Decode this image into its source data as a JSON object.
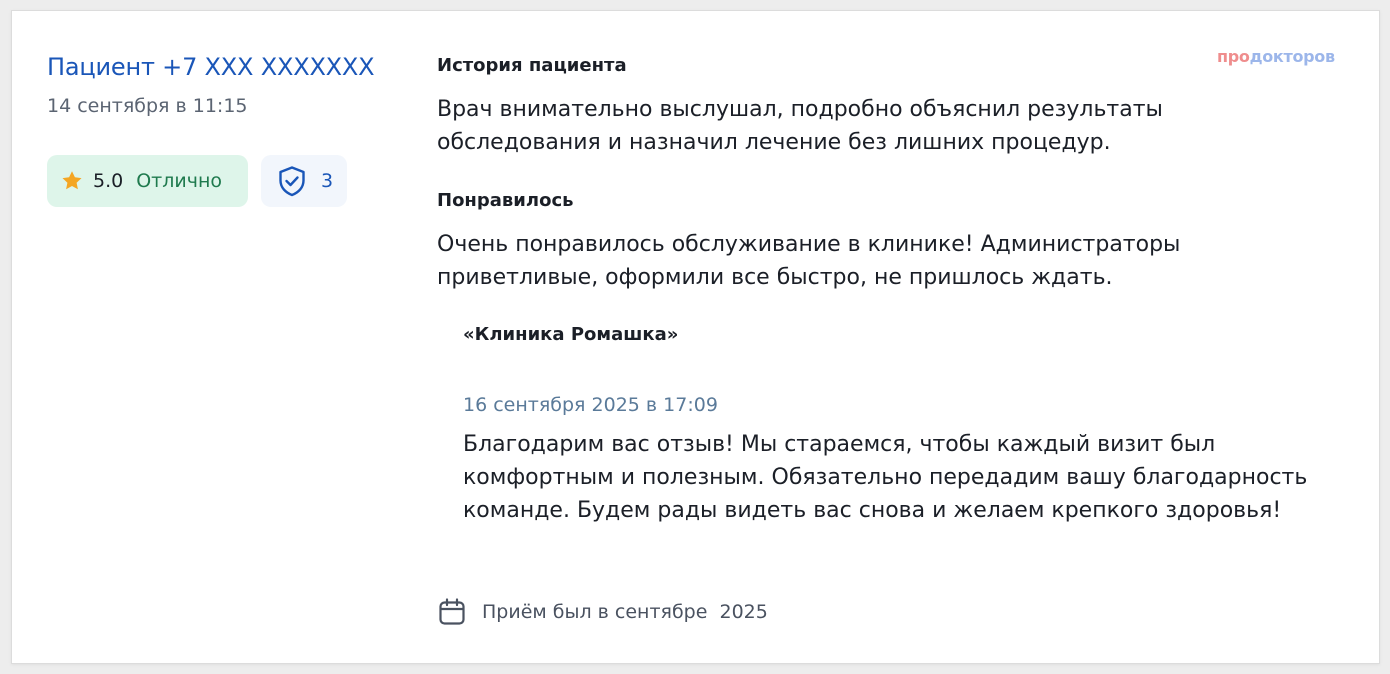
{
  "review": {
    "author": "Пациент +7 XXX XXXXXXX",
    "date": "14 сентября в 11:15",
    "rating": {
      "value": "5.0",
      "label": "Отлично",
      "icon": "star-icon",
      "star_color": "#f4a623",
      "badge_bg": "#def5ea",
      "label_color": "#1f7a4e"
    },
    "verification": {
      "icon": "shield-check-icon",
      "count": "3",
      "color": "#1a56b8"
    },
    "history": {
      "title": "История пациента",
      "text": "Врач внимательно выслушал, подробно объяснил результаты обследования и назначил лечение без лишних процедур."
    },
    "liked": {
      "title": "Понравилось",
      "text": "Очень понравилось обслуживание в клинике! Администраторы приветливые, оформили все быстро, не пришлось ждать."
    },
    "reply": {
      "author": "«Клиника Ромашка»",
      "date": "16 сентября 2025 в 17:09",
      "text": "Благодарим вас отзыв! Мы стараемся, чтобы каждый визит был комфортным и полезным. Обязательно передадим вашу благодарность команде. Будем рады видеть вас снова и желаем крепкого здоровья!"
    },
    "visit": {
      "icon": "calendar-icon",
      "text": "Приём был в сентябре  2025"
    }
  },
  "logo": {
    "part1": "про",
    "part2": "докторов",
    "color1": "#ef8d8d",
    "color2": "#9cb6ea"
  },
  "colors": {
    "link": "#1a56b8",
    "muted": "#5b6472",
    "reply_date": "#5a7a99",
    "text": "#1b1f27"
  }
}
